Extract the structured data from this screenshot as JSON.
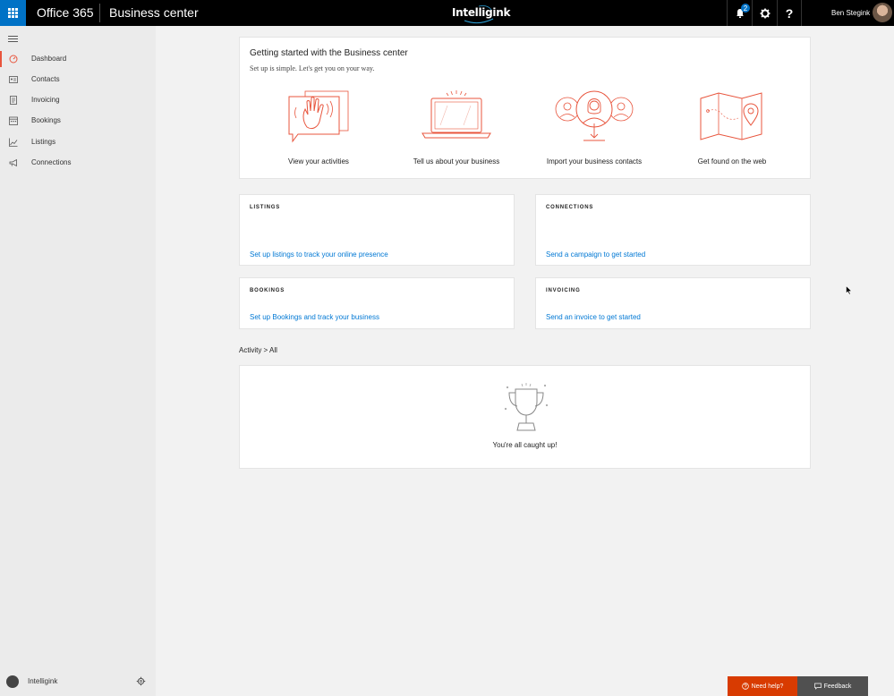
{
  "topbar": {
    "suite_name": "Office 365",
    "app_title": "Business center",
    "brand_logo": "Intelligink",
    "notification_count": "2",
    "help_glyph": "?",
    "user_name": "Ben Stegink"
  },
  "sidebar": {
    "items": [
      {
        "label": "Dashboard",
        "icon": "dashboard-icon",
        "active": true
      },
      {
        "label": "Contacts",
        "icon": "contact-card-icon",
        "active": false
      },
      {
        "label": "Invoicing",
        "icon": "invoice-icon",
        "active": false
      },
      {
        "label": "Bookings",
        "icon": "calendar-icon",
        "active": false
      },
      {
        "label": "Listings",
        "icon": "line-chart-icon",
        "active": false
      },
      {
        "label": "Connections",
        "icon": "megaphone-icon",
        "active": false
      }
    ],
    "org_name": "Intelligink"
  },
  "getting_started": {
    "title": "Getting started with the Business center",
    "subtitle": "Set up is simple. Let's get you on your way.",
    "items": [
      {
        "label": "View your activities",
        "icon": "waving-hand-icon"
      },
      {
        "label": "Tell us about your business",
        "icon": "laptop-icon"
      },
      {
        "label": "Import your business contacts",
        "icon": "contacts-import-icon"
      },
      {
        "label": "Get found on the web",
        "icon": "map-pin-icon"
      }
    ]
  },
  "tiles": {
    "listings": {
      "heading": "LISTINGS",
      "link": "Set up listings to track your online presence"
    },
    "connections": {
      "heading": "CONNECTIONS",
      "link": "Send a campaign to get started"
    },
    "bookings": {
      "heading": "BOOKINGS",
      "link": "Set up Bookings and track your business"
    },
    "invoicing": {
      "heading": "INVOICING",
      "link": "Send an invoice to get started"
    }
  },
  "activity": {
    "breadcrumb": "Activity > All",
    "empty_message": "You're all caught up!"
  },
  "footer": {
    "need_help": "Need help?",
    "feedback": "Feedback"
  },
  "colors": {
    "accent": "#0072c6",
    "illustration": "#e8553d",
    "link": "#0078d4",
    "need_help_bg": "#d83b01"
  }
}
